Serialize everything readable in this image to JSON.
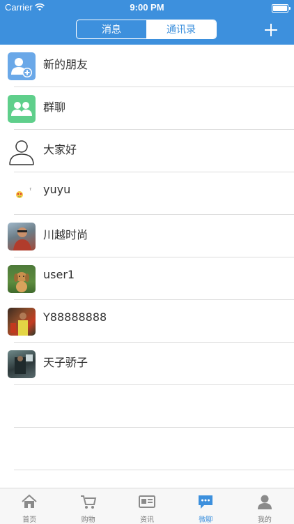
{
  "status": {
    "carrier": "Carrier",
    "time": "9:00 PM"
  },
  "header": {
    "seg_left": "消息",
    "seg_right": "通讯录",
    "active_segment": "通讯录",
    "accent": "#3d90dd"
  },
  "contacts": [
    {
      "name": "新的朋友",
      "icon": "add-friend-icon"
    },
    {
      "name": "群聊",
      "icon": "group-icon"
    },
    {
      "name": "大家好",
      "icon": "person-outline-icon"
    },
    {
      "name": "yuyu",
      "icon": "emoji-avatar"
    },
    {
      "name": "川越时尚",
      "icon": "photo-avatar"
    },
    {
      "name": "user1",
      "icon": "dog-photo-avatar"
    },
    {
      "name": "Y88888888",
      "icon": "photo-avatar"
    },
    {
      "name": "天子骄子",
      "icon": "photo-avatar"
    }
  ],
  "tabbar": {
    "items": [
      {
        "label": "首页",
        "icon": "home-icon"
      },
      {
        "label": "购物",
        "icon": "cart-icon"
      },
      {
        "label": "资讯",
        "icon": "news-icon"
      },
      {
        "label": "微聊",
        "icon": "chat-icon"
      },
      {
        "label": "我的",
        "icon": "user-icon"
      }
    ],
    "active": "微聊"
  }
}
